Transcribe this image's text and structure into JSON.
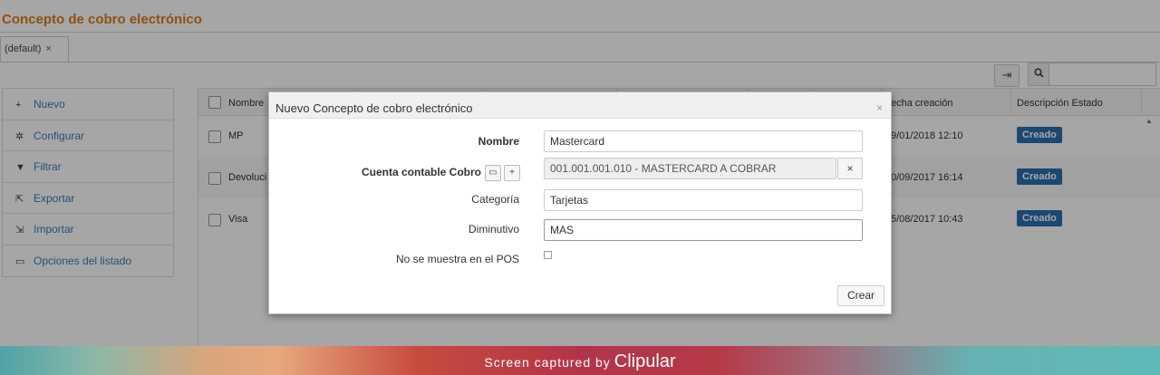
{
  "page_title": "Concepto de cobro electrónico",
  "tab": {
    "label": "(default)",
    "close": "×"
  },
  "toolbar": {
    "export_icon": "column-config-icon",
    "search_icon": "search-icon",
    "search_value": ""
  },
  "sidebar": {
    "items": [
      {
        "label": "Nuevo",
        "icon": "plus-icon",
        "glyph": "+"
      },
      {
        "label": "Configurar",
        "icon": "gear-icon",
        "glyph": "✲"
      },
      {
        "label": "Filtrar",
        "icon": "filter-icon",
        "glyph": "▼"
      },
      {
        "label": "Exportar",
        "icon": "export-icon",
        "glyph": "⇱"
      },
      {
        "label": "Importar",
        "icon": "import-icon",
        "glyph": "⇲"
      },
      {
        "label": "Opciones del listado",
        "icon": "print-icon",
        "glyph": "▭"
      }
    ]
  },
  "table": {
    "headers": {
      "nombre": "Nombre",
      "fecha": "echa creación",
      "estado": "Descripción Estado"
    },
    "rows": [
      {
        "nombre": "MP",
        "fecha": "9/01/2018 12:10",
        "estado": "Creado"
      },
      {
        "nombre": "Devoluci",
        "fecha": "0/09/2017 16:14",
        "estado": "Creado"
      },
      {
        "nombre": "Visa",
        "fecha": "5/08/2017 10:43",
        "estado": "Creado"
      }
    ]
  },
  "modal": {
    "title": "Nuevo Concepto de cobro electrónico",
    "close": "×",
    "nombre_label": "Nombre",
    "nombre_value": "Mastercard",
    "cuenta_label": "Cuenta contable Cobro",
    "cuenta_value": "001.001.001.010 - MASTERCARD A COBRAR",
    "cuenta_clear": "×",
    "categoria_label": "Categoría",
    "categoria_value": "Tarjetas",
    "diminutivo_label": "Diminutivo",
    "diminutivo_value": "MAS",
    "pos_label": "No se muestra en el POS",
    "pos_checked": false,
    "crear_label": "Crear"
  },
  "footer": {
    "text": "Screen captured by",
    "brand": "Clipular"
  }
}
